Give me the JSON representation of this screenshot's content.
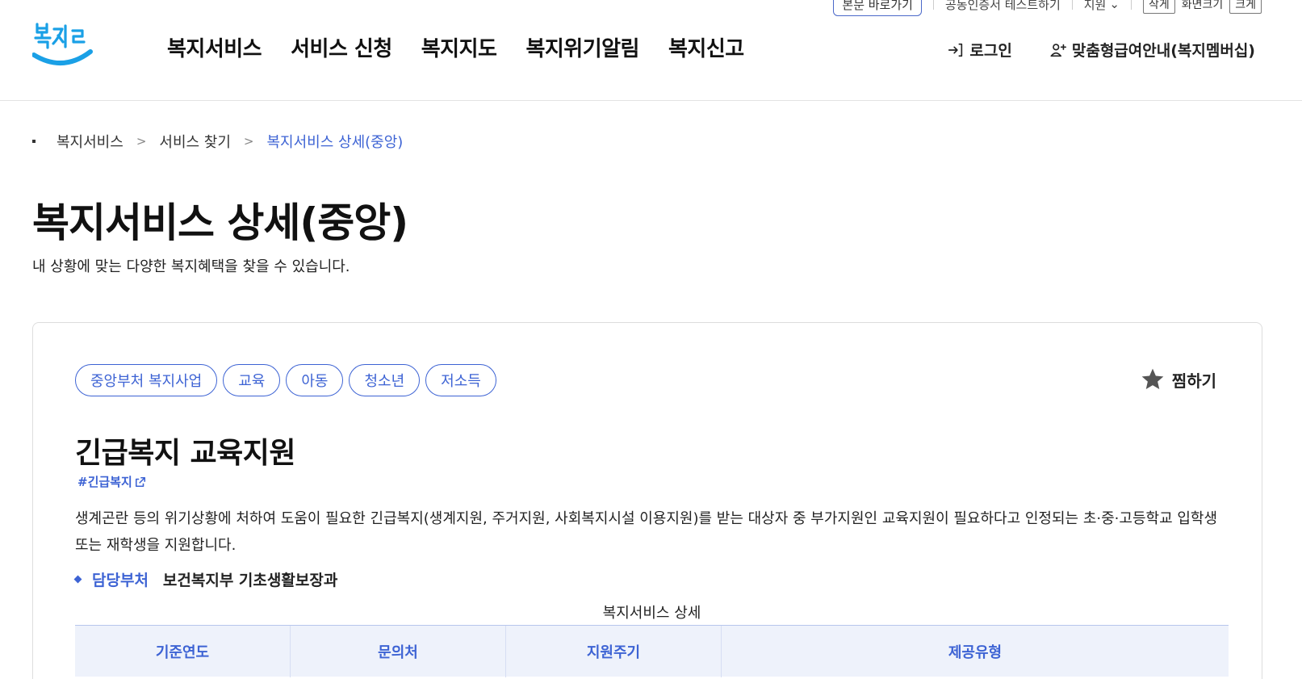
{
  "util_bar": {
    "skip_link": "본문 바로가기",
    "public_cert": "공동인증서 테스트하기",
    "lang": "지원",
    "size_small": "작게",
    "size_reset": "화면크기",
    "size_large": "크게"
  },
  "header": {
    "logo_text": "복지로",
    "gnb": [
      {
        "label": "복지서비스"
      },
      {
        "label": "서비스 신청"
      },
      {
        "label": "복지지도"
      },
      {
        "label": "복지위기알림"
      },
      {
        "label": "복지신고"
      }
    ],
    "login_label": "로그인",
    "membership_label": "맞춤형급여안내(복지멤버십)"
  },
  "breadcrumb": {
    "items": [
      "복지서비스",
      "서비스 찾기",
      "복지서비스 상세(중앙)"
    ]
  },
  "page": {
    "title": "복지서비스 상세(중앙)",
    "description": "내 상황에 맞는 다양한 복지혜택을 찾을 수 있습니다."
  },
  "service": {
    "tags": [
      "중앙부처 복지사업",
      "교육",
      "아동",
      "청소년",
      "저소득"
    ],
    "favorite_label": "찜하기",
    "title": "긴급복지 교육지원",
    "hashtag": "#긴급복지",
    "description": "생계곤란 등의 위기상황에 처하여 도움이 필요한 긴급복지(생계지원, 주거지원, 사회복지시설 이용지원)를 받는 대상자 중 부가지원인 교육지원이 필요하다고 인정되는 초·중·고등학교 입학생 또는 재학생을 지원합니다.",
    "dept_label": "담당부처",
    "dept_value": "보건복지부 기초생활보장과",
    "table_caption": "복지서비스 상세",
    "table_headers": [
      "기준연도",
      "문의처",
      "지원주기",
      "제공유형"
    ]
  },
  "colors": {
    "accent": "#3d63d4",
    "logo_blue": "#1aa0e6",
    "table_bg": "#eef2fb"
  }
}
